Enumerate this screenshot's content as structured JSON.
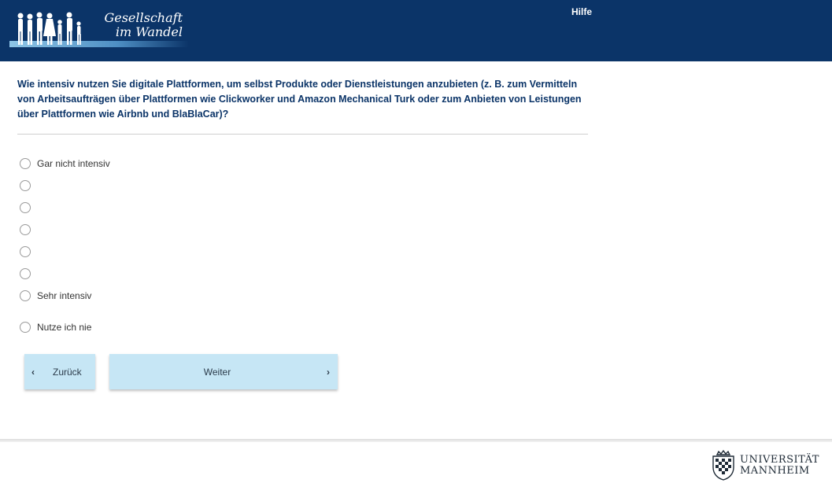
{
  "header": {
    "logo_line1": "Gesellschaft",
    "logo_line2": "im Wandel",
    "help_label": "Hilfe",
    "background_color": "#0b3468"
  },
  "question": {
    "text": "Wie intensiv nutzen Sie digitale Plattformen, um selbst Produkte oder Dienstleistungen anzubieten (z. B. zum Vermitteln von Arbeitsaufträgen über Plattformen wie Clickworker und Amazon Mechanical Turk oder zum Anbieten von Leistungen über Plattformen wie Airbnb und BlaBlaCar)?"
  },
  "options": [
    {
      "label": "Gar nicht intensiv",
      "selected": false
    },
    {
      "label": "",
      "selected": false
    },
    {
      "label": "",
      "selected": false
    },
    {
      "label": "",
      "selected": false
    },
    {
      "label": "",
      "selected": false
    },
    {
      "label": "",
      "selected": false
    },
    {
      "label": "Sehr intensiv",
      "selected": false
    },
    {
      "label": "Nutze ich nie",
      "selected": false
    }
  ],
  "navigation": {
    "back_label": "Zurück",
    "next_label": "Weiter",
    "button_color": "#c6e6f5"
  },
  "footer": {
    "university_line1": "UNIVERSITÄT",
    "university_line2": "MANNHEIM"
  }
}
